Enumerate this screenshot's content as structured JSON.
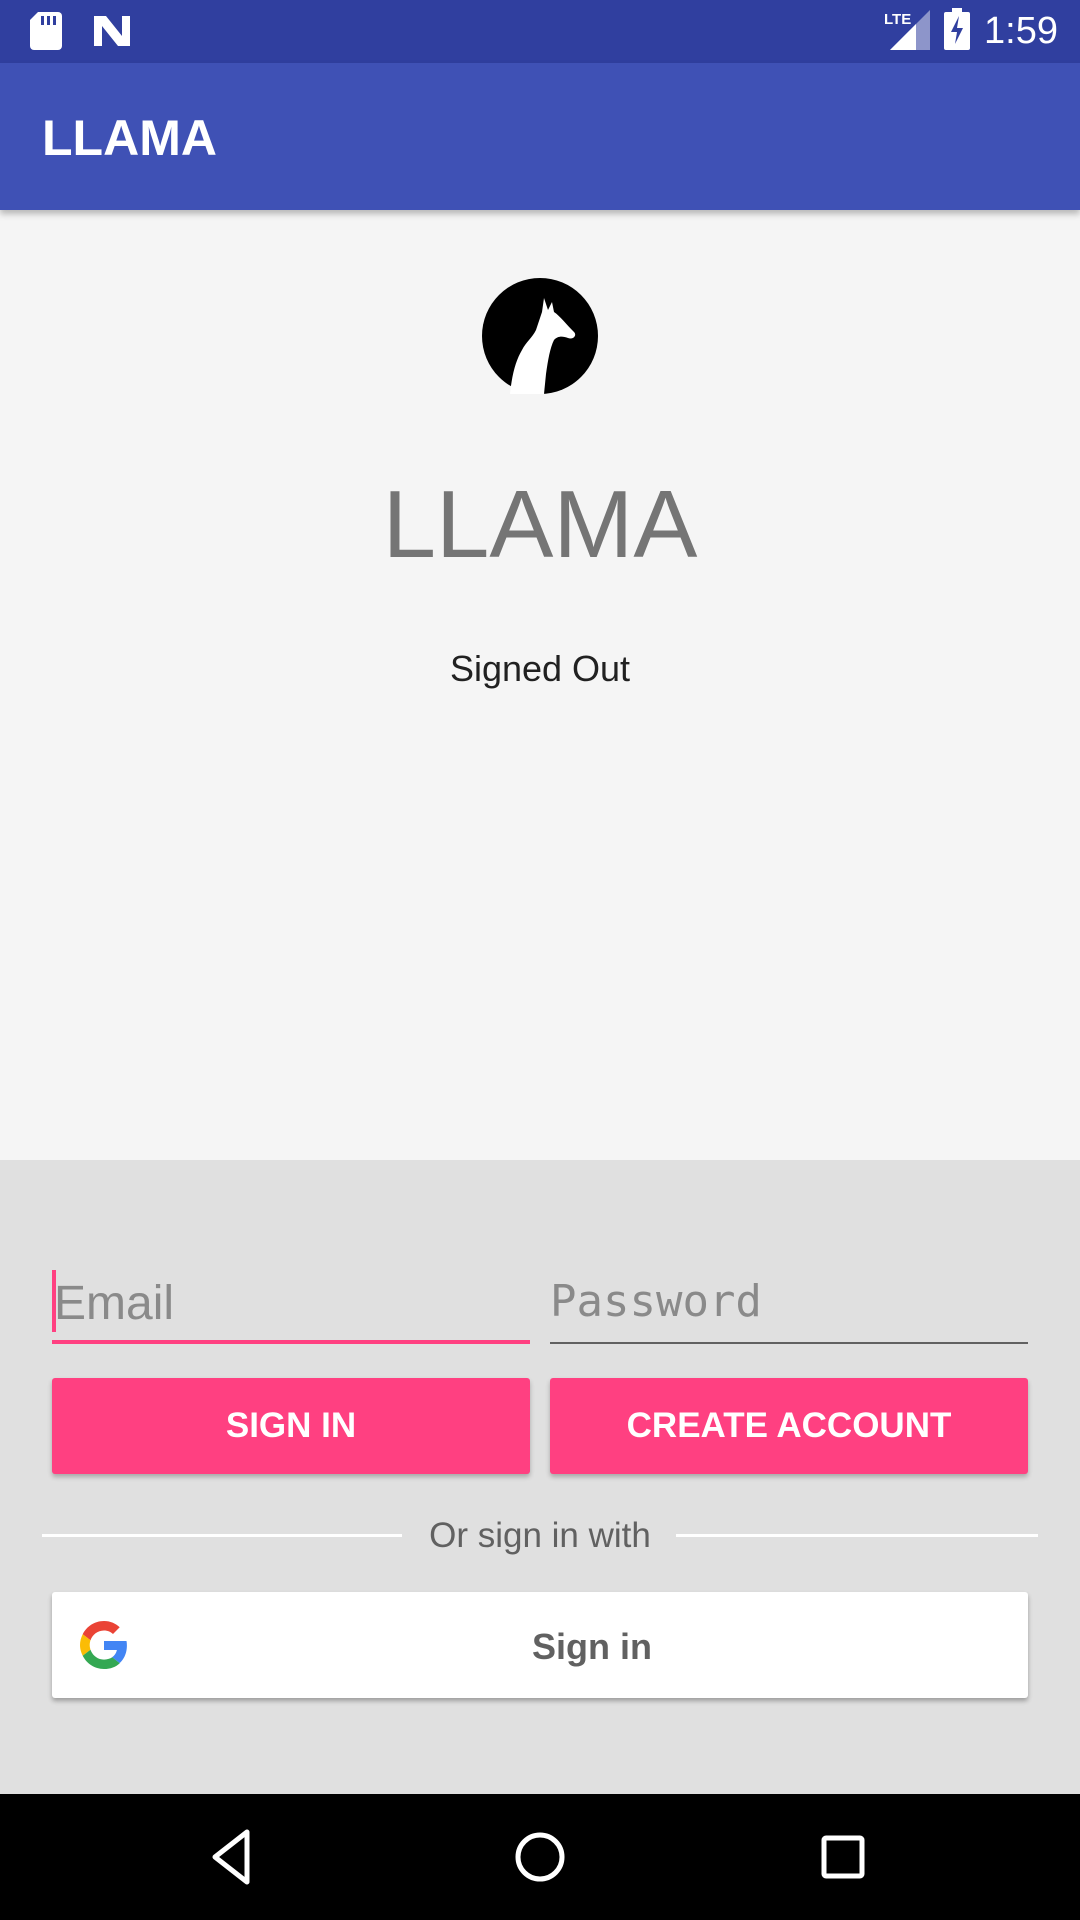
{
  "status_bar": {
    "time": "1:59",
    "network_label": "LTE",
    "icons": [
      "sd-card-icon",
      "n-notification-icon",
      "signal-icon",
      "battery-charging-icon"
    ]
  },
  "app_bar": {
    "title": "LLAMA"
  },
  "main": {
    "logo_icon": "llama-logo-icon",
    "title": "LLAMA",
    "auth_status": "Signed Out"
  },
  "form": {
    "email_placeholder": "Email",
    "password_placeholder": "Password",
    "sign_in_label": "SIGN IN",
    "create_account_label": "CREATE ACCOUNT",
    "divider_text": "Or sign in with",
    "google_sign_in_label": "Sign in",
    "google_icon": "google-g-icon"
  },
  "nav_bar": {
    "icons": [
      "back-icon",
      "home-icon",
      "recents-icon"
    ]
  },
  "colors": {
    "status_bar": "#303f9f",
    "primary": "#3f51b5",
    "accent": "#ff4081",
    "background": "#f5f5f5",
    "panel": "#e0e0e0"
  }
}
